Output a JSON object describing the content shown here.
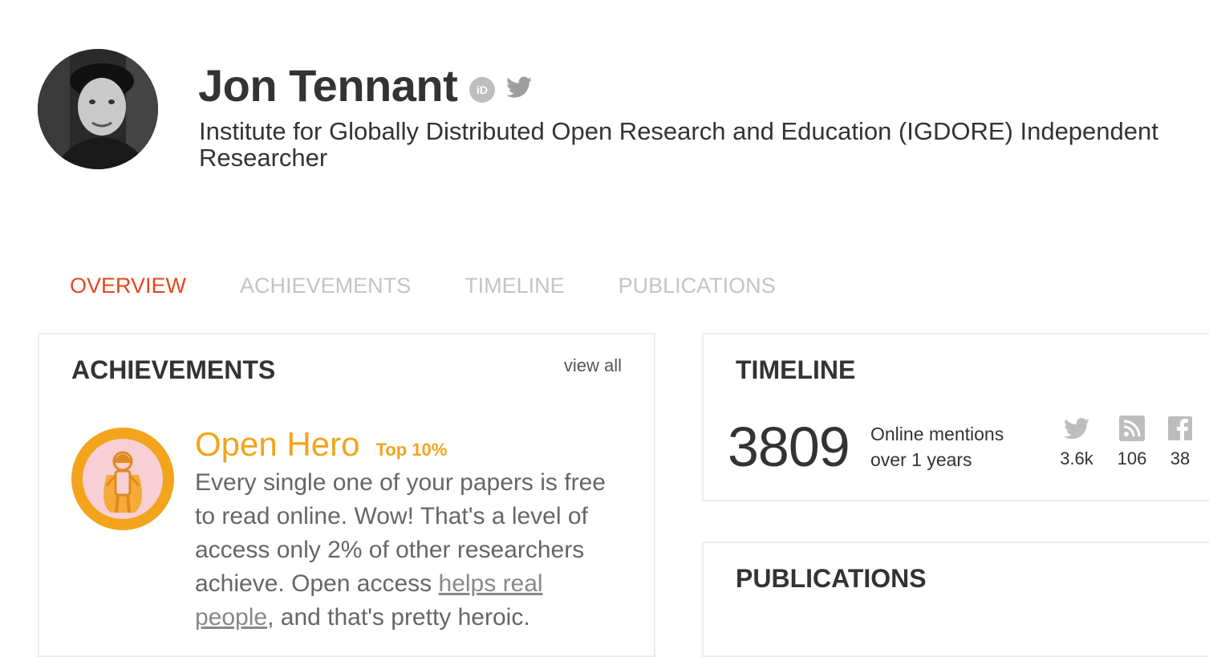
{
  "profile": {
    "name": "Jon Tennant",
    "affiliation": "Institute for Globally Distributed Open Research and Education (IGDORE) Independent Researcher",
    "orcid_label": "iD"
  },
  "tabs": [
    {
      "label": "OVERVIEW",
      "active": true
    },
    {
      "label": "ACHIEVEMENTS",
      "active": false
    },
    {
      "label": "TIMELINE",
      "active": false
    },
    {
      "label": "PUBLICATIONS",
      "active": false
    }
  ],
  "achievements": {
    "title": "ACHIEVEMENTS",
    "view_all": "view all",
    "item": {
      "name": "Open Hero",
      "rank": "Top 10%",
      "desc_before": "Every single one of your papers is free to read online. Wow! That's a level of access only 2% of other researchers achieve. Open access ",
      "desc_link": "helps real people",
      "desc_after": ", and that's pretty heroic.",
      "icon": "superhero-badge-icon"
    }
  },
  "timeline": {
    "title": "TIMELINE",
    "count": "3809",
    "label_line1": "Online mentions",
    "label_line2": "over 1 years",
    "sources": [
      {
        "icon": "twitter-icon",
        "value": "3.6k"
      },
      {
        "icon": "rss-icon",
        "value": "106"
      },
      {
        "icon": "facebook-icon",
        "value": "38"
      }
    ]
  },
  "publications": {
    "title": "PUBLICATIONS"
  },
  "colors": {
    "accent": "#e8461f",
    "badge": "#f3a41c",
    "tab_inactive": "#c4c4c4",
    "icon_gray": "#bdbdbd"
  }
}
